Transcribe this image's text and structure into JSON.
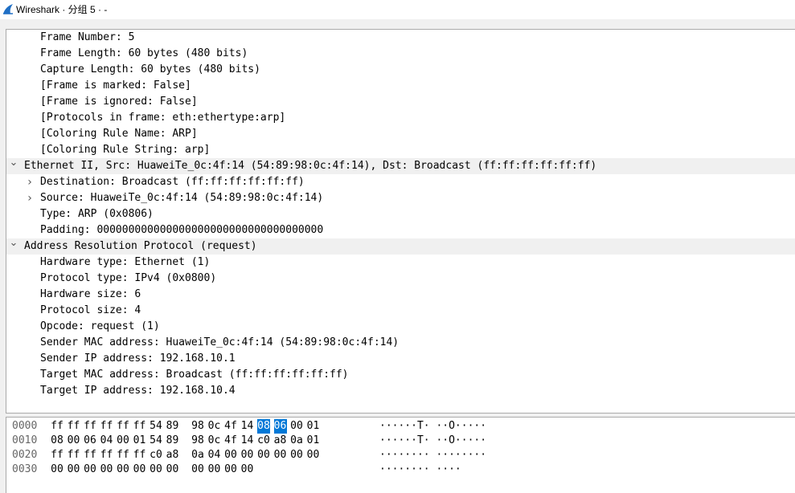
{
  "window": {
    "title": "Wireshark · 分组 5 · -",
    "icon": "shark-fin-icon"
  },
  "tree": [
    {
      "text": "Frame Number: 5",
      "level": 1,
      "expander": "none",
      "highlight": false
    },
    {
      "text": "Frame Length: 60 bytes (480 bits)",
      "level": 1,
      "expander": "none",
      "highlight": false
    },
    {
      "text": "Capture Length: 60 bytes (480 bits)",
      "level": 1,
      "expander": "none",
      "highlight": false
    },
    {
      "text": "[Frame is marked: False]",
      "level": 1,
      "expander": "none",
      "highlight": false
    },
    {
      "text": "[Frame is ignored: False]",
      "level": 1,
      "expander": "none",
      "highlight": false
    },
    {
      "text": "[Protocols in frame: eth:ethertype:arp]",
      "level": 1,
      "expander": "none",
      "highlight": false
    },
    {
      "text": "[Coloring Rule Name: ARP]",
      "level": 1,
      "expander": "none",
      "highlight": false
    },
    {
      "text": "[Coloring Rule String: arp]",
      "level": 1,
      "expander": "none",
      "highlight": false
    },
    {
      "text": "Ethernet II, Src: HuaweiTe_0c:4f:14 (54:89:98:0c:4f:14), Dst: Broadcast (ff:ff:ff:ff:ff:ff)",
      "level": 0,
      "expander": "expanded",
      "highlight": true
    },
    {
      "text": "Destination: Broadcast (ff:ff:ff:ff:ff:ff)",
      "level": 1,
      "expander": "collapsed",
      "highlight": false
    },
    {
      "text": "Source: HuaweiTe_0c:4f:14 (54:89:98:0c:4f:14)",
      "level": 1,
      "expander": "collapsed",
      "highlight": false
    },
    {
      "text": "Type: ARP (0x0806)",
      "level": 1,
      "expander": "none",
      "highlight": false
    },
    {
      "text": "Padding: 000000000000000000000000000000000000",
      "level": 1,
      "expander": "none",
      "highlight": false
    },
    {
      "text": "Address Resolution Protocol (request)",
      "level": 0,
      "expander": "expanded",
      "highlight": true
    },
    {
      "text": "Hardware type: Ethernet (1)",
      "level": 1,
      "expander": "none",
      "highlight": false
    },
    {
      "text": "Protocol type: IPv4 (0x0800)",
      "level": 1,
      "expander": "none",
      "highlight": false
    },
    {
      "text": "Hardware size: 6",
      "level": 1,
      "expander": "none",
      "highlight": false
    },
    {
      "text": "Protocol size: 4",
      "level": 1,
      "expander": "none",
      "highlight": false
    },
    {
      "text": "Opcode: request (1)",
      "level": 1,
      "expander": "none",
      "highlight": false
    },
    {
      "text": "Sender MAC address: HuaweiTe_0c:4f:14 (54:89:98:0c:4f:14)",
      "level": 1,
      "expander": "none",
      "highlight": false
    },
    {
      "text": "Sender IP address: 192.168.10.1",
      "level": 1,
      "expander": "none",
      "highlight": false
    },
    {
      "text": "Target MAC address: Broadcast (ff:ff:ff:ff:ff:ff)",
      "level": 1,
      "expander": "none",
      "highlight": false
    },
    {
      "text": "Target IP address: 192.168.10.4",
      "level": 1,
      "expander": "none",
      "highlight": false
    }
  ],
  "hex": [
    {
      "offset": "0000",
      "bytes": [
        "ff",
        "ff",
        "ff",
        "ff",
        "ff",
        "ff",
        "54",
        "89",
        "98",
        "0c",
        "4f",
        "14",
        "08",
        "06",
        "00",
        "01"
      ],
      "ascii": "······T· ··O·····",
      "selected": [
        12,
        13
      ]
    },
    {
      "offset": "0010",
      "bytes": [
        "08",
        "00",
        "06",
        "04",
        "00",
        "01",
        "54",
        "89",
        "98",
        "0c",
        "4f",
        "14",
        "c0",
        "a8",
        "0a",
        "01"
      ],
      "ascii": "······T· ··O·····",
      "selected": []
    },
    {
      "offset": "0020",
      "bytes": [
        "ff",
        "ff",
        "ff",
        "ff",
        "ff",
        "ff",
        "c0",
        "a8",
        "0a",
        "04",
        "00",
        "00",
        "00",
        "00",
        "00",
        "00"
      ],
      "ascii": "········ ········",
      "selected": []
    },
    {
      "offset": "0030",
      "bytes": [
        "00",
        "00",
        "00",
        "00",
        "00",
        "00",
        "00",
        "00",
        "00",
        "00",
        "00",
        "00"
      ],
      "ascii": "········ ····",
      "selected": []
    }
  ],
  "colors": {
    "selection": "#0078d7",
    "tree_highlight": "#f0f0f0",
    "offset_text": "#666666"
  }
}
